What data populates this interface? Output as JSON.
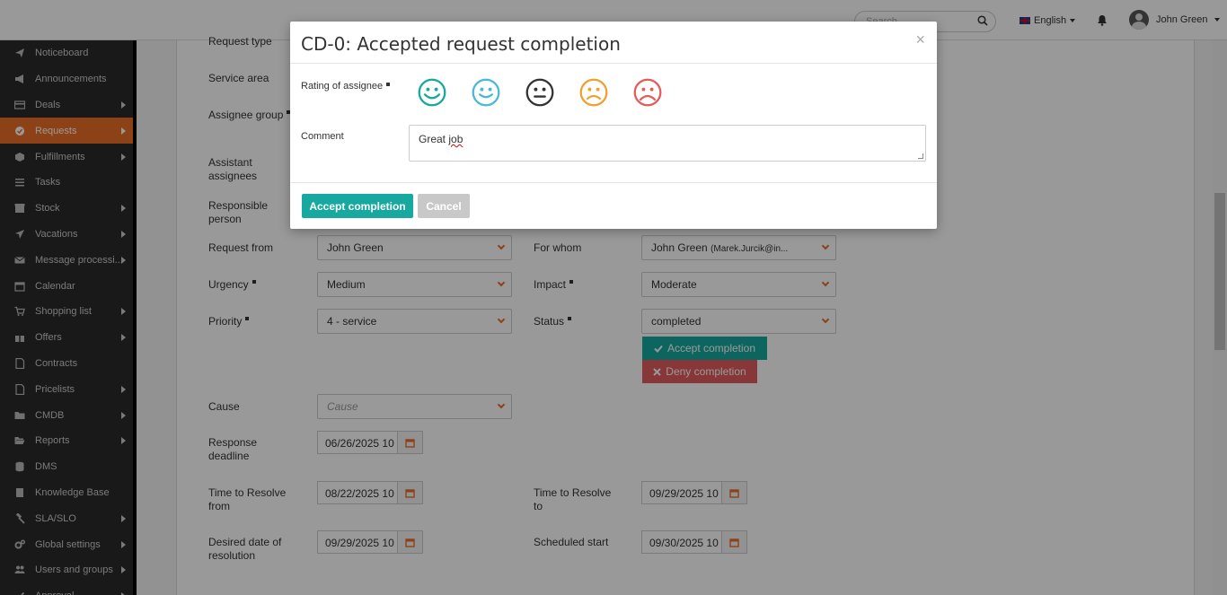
{
  "topbar": {
    "search_placeholder": "Search",
    "language": "English",
    "user_name": "John Green"
  },
  "sidebar": {
    "items": [
      {
        "label": "Noticeboard",
        "icon": "paper-plane-icon",
        "arrow": false,
        "active": false
      },
      {
        "label": "Announcements",
        "icon": "megaphone-icon",
        "arrow": false,
        "active": false
      },
      {
        "label": "Deals",
        "icon": "card-icon",
        "arrow": true,
        "active": false
      },
      {
        "label": "Requests",
        "icon": "check-circle-icon",
        "arrow": true,
        "active": true
      },
      {
        "label": "Fulfillments",
        "icon": "cube-icon",
        "arrow": true,
        "active": false
      },
      {
        "label": "Tasks",
        "icon": "list-icon",
        "arrow": false,
        "active": false
      },
      {
        "label": "Stock",
        "icon": "box-icon",
        "arrow": true,
        "active": false
      },
      {
        "label": "Vacations",
        "icon": "plane-icon",
        "arrow": true,
        "active": false
      },
      {
        "label": "Message processi...",
        "icon": "envelope-icon",
        "arrow": true,
        "active": false
      },
      {
        "label": "Calendar",
        "icon": "calendar-icon",
        "arrow": false,
        "active": false
      },
      {
        "label": "Shopping list",
        "icon": "cart-icon",
        "arrow": true,
        "active": false
      },
      {
        "label": "Offers",
        "icon": "gift-icon",
        "arrow": true,
        "active": false
      },
      {
        "label": "Contracts",
        "icon": "document-icon",
        "arrow": false,
        "active": false
      },
      {
        "label": "Pricelists",
        "icon": "document-icon",
        "arrow": true,
        "active": false
      },
      {
        "label": "CMDB",
        "icon": "folder-icon",
        "arrow": true,
        "active": false
      },
      {
        "label": "Reports",
        "icon": "folder-open-icon",
        "arrow": true,
        "active": false
      },
      {
        "label": "DMS",
        "icon": "database-icon",
        "arrow": false,
        "active": false
      },
      {
        "label": "Knowledge Base",
        "icon": "book-icon",
        "arrow": false,
        "active": false
      },
      {
        "label": "SLA/SLO",
        "icon": "gavel-icon",
        "arrow": true,
        "active": false
      },
      {
        "label": "Global settings",
        "icon": "cogs-icon",
        "arrow": true,
        "active": false
      },
      {
        "label": "Users and groups",
        "icon": "users-icon",
        "arrow": true,
        "active": false
      },
      {
        "label": "Approval",
        "icon": "check-icon",
        "arrow": true,
        "active": false
      }
    ]
  },
  "form": {
    "request_type_label": "Request type",
    "service_area_label": "Service area",
    "assignee_group_label": "Assignee group",
    "assistant_assignees_label_1": "Assistant",
    "assistant_assignees_label_2": "assignees",
    "responsible_person_label_1": "Responsible",
    "responsible_person_label_2": "person",
    "request_from_label": "Request from",
    "request_from_value": "John Green",
    "for_whom_label": "For whom",
    "for_whom_value": "John Green",
    "for_whom_email": "(Marek.Jurcik@in...",
    "urgency_label": "Urgency",
    "urgency_value": "Medium",
    "impact_label": "Impact",
    "impact_value": "Moderate",
    "priority_label": "Priority",
    "priority_value": "4 - service",
    "status_label": "Status",
    "status_value": "completed",
    "accept_completion": "Accept completion",
    "deny_completion": "Deny completion",
    "cause_label": "Cause",
    "cause_placeholder": "Cause",
    "response_deadline_label_1": "Response",
    "response_deadline_label_2": "deadline",
    "response_deadline_value": "06/26/2025 10",
    "ttr_from_label_1": "Time to Resolve",
    "ttr_from_label_2": "from",
    "ttr_from_value": "08/22/2025 10",
    "ttr_to_label_1": "Time to Resolve",
    "ttr_to_label_2": "to",
    "ttr_to_value": "09/29/2025 10",
    "desired_label_1": "Desired date of",
    "desired_label_2": "resolution",
    "desired_value": "09/29/2025 10",
    "scheduled_start_label": "Scheduled start",
    "scheduled_start_value": "09/30/2025 10"
  },
  "modal": {
    "title": "CD-0: Accepted request completion",
    "close": "×",
    "rating_label": "Rating of assignee",
    "comment_label": "Comment",
    "comment_prefix": "Great ",
    "comment_misspelled": "job",
    "accept_button": "Accept completion",
    "cancel_button": "Cancel",
    "smileys": [
      {
        "name": "very-happy-face-icon",
        "color": "#17a8a0"
      },
      {
        "name": "happy-face-icon",
        "color": "#4bb8d8"
      },
      {
        "name": "neutral-face-icon",
        "color": "#333333"
      },
      {
        "name": "sad-face-icon",
        "color": "#f0a030"
      },
      {
        "name": "very-sad-face-icon",
        "color": "#e25c5c"
      }
    ]
  }
}
